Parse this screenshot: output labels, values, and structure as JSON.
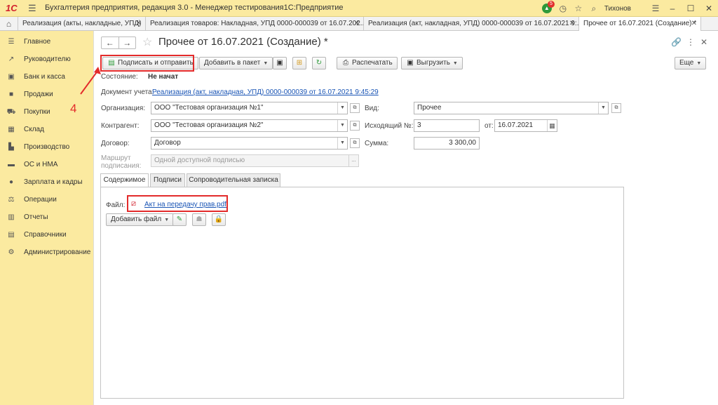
{
  "titlebar": {
    "logo": "1С",
    "menu_icon": "hamburger-icon",
    "title": "Бухгалтерия предприятия, редакция 3.0  - Менеджер тестирования1С:Предприятие",
    "notification_count": "5",
    "user": "Тихонов",
    "icons": [
      "notification-icon",
      "history-icon",
      "star-icon",
      "search-icon",
      "menu-icon",
      "minimize-icon",
      "maximize-icon",
      "close-icon"
    ],
    "accent": "#fbeaa0"
  },
  "tabs": [
    {
      "label": "Реализация (акты, накладные, УПД)"
    },
    {
      "label": "Реализация товаров: Накладная, УПД 0000-000039 от 16.07.202..."
    },
    {
      "label": "Реализация (акт, накладная, УПД) 0000-000039 от 16.07.2021 9:..."
    },
    {
      "label": "Прочее от 16.07.2021 (Создание) *"
    }
  ],
  "sidebar": {
    "items": [
      {
        "label": "Главное",
        "icon": "menu-icon"
      },
      {
        "label": "Руководителю",
        "icon": "chart-icon"
      },
      {
        "label": "Банк и касса",
        "icon": "bank-icon"
      },
      {
        "label": "Продажи",
        "icon": "bag-icon"
      },
      {
        "label": "Покупки",
        "icon": "cart-icon"
      },
      {
        "label": "Склад",
        "icon": "warehouse-icon"
      },
      {
        "label": "Производство",
        "icon": "factory-icon"
      },
      {
        "label": "ОС и НМА",
        "icon": "truck-icon"
      },
      {
        "label": "Зарплата и кадры",
        "icon": "people-icon"
      },
      {
        "label": "Операции",
        "icon": "operations-icon"
      },
      {
        "label": "Отчеты",
        "icon": "report-icon"
      },
      {
        "label": "Справочники",
        "icon": "book-icon"
      },
      {
        "label": "Администрирование",
        "icon": "gear-icon"
      }
    ]
  },
  "form": {
    "title": "Прочее от 16.07.2021 (Создание) *",
    "toolbar": {
      "sign_send": "Подписать и отправить",
      "add_package": "Добавить в пакет",
      "print": "Распечатать",
      "export": "Выгрузить",
      "more": "Еще"
    },
    "annotation_number": "4",
    "state_label": "Состояние:",
    "state_value": "Не начат",
    "doc_label": "Документ учета:",
    "doc_link": "Реализация (акт, накладная, УПД) 0000-000039 от 16.07.2021 9:45:29",
    "org_label": "Организация:",
    "org_value": "ООО \"Тестовая организация №1\"",
    "contr_label": "Контрагент:",
    "contr_value": "ООО \"Тестовая организация №2\"",
    "contract_label": "Договор:",
    "contract_value": "Договор",
    "route_label_1": "Маршрут",
    "route_label_2": "подписания:",
    "route_value": "Одной доступной подписью",
    "kind_label": "Вид:",
    "kind_value": "Прочее",
    "outgoing_label": "Исходящий №:",
    "outgoing_value": "3",
    "date_label": "от:",
    "date_value": "16.07.2021",
    "sum_label": "Сумма:",
    "sum_value": "3 300,00"
  },
  "panel_tabs": [
    {
      "label": "Содержимое"
    },
    {
      "label": "Подписи"
    },
    {
      "label": "Сопроводительная записка"
    }
  ],
  "content_tab": {
    "file_label": "Файл:",
    "file_link": "Акт на передачу прав.pdf",
    "add_file": "Добавить файл"
  }
}
